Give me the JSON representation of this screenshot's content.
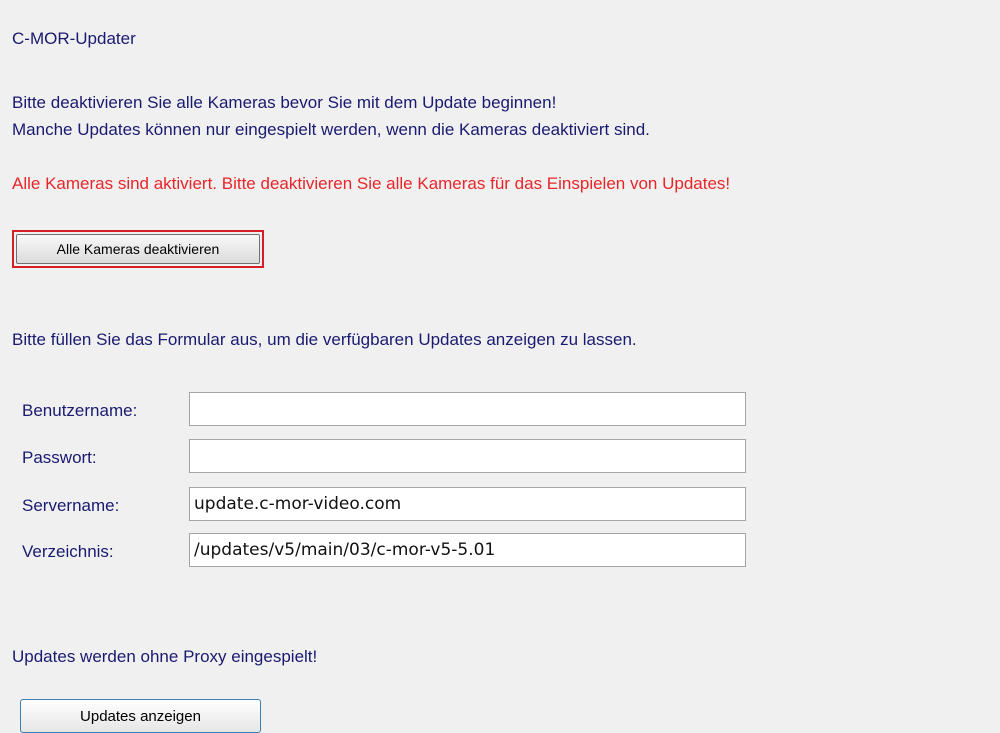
{
  "app": {
    "title": "C-MOR-Updater"
  },
  "intro": {
    "line1": "Bitte deaktivieren Sie alle Kameras bevor Sie mit dem Update beginnen!",
    "line2": "Manche Updates können nur eingespielt werden, wenn die Kameras deaktiviert sind."
  },
  "warning": {
    "text": "Alle Kameras sind aktiviert. Bitte deaktivieren Sie alle Kameras für das Einspielen von Updates!",
    "color": "#e8262a"
  },
  "deactivate": {
    "label": "Alle Kameras deaktivieren",
    "highlight_color": "#d81e22"
  },
  "form": {
    "intro": "Bitte füllen Sie das Formular aus, um die verfügbaren Updates anzeigen zu lassen.",
    "fields": {
      "username": {
        "label": "Benutzername:",
        "value": ""
      },
      "password": {
        "label": "Passwort:",
        "value": ""
      },
      "server": {
        "label": "Servername:",
        "value": "update.c-mor-video.com"
      },
      "directory": {
        "label": "Verzeichnis:",
        "value": "/updates/v5/main/03/c-mor-v5-5.01"
      }
    }
  },
  "proxy": {
    "note": "Updates werden ohne Proxy eingespielt!"
  },
  "actions": {
    "show_updates_label": "Updates anzeigen"
  },
  "colors": {
    "background": "#f0f0f0",
    "text": "#1a1a70"
  }
}
